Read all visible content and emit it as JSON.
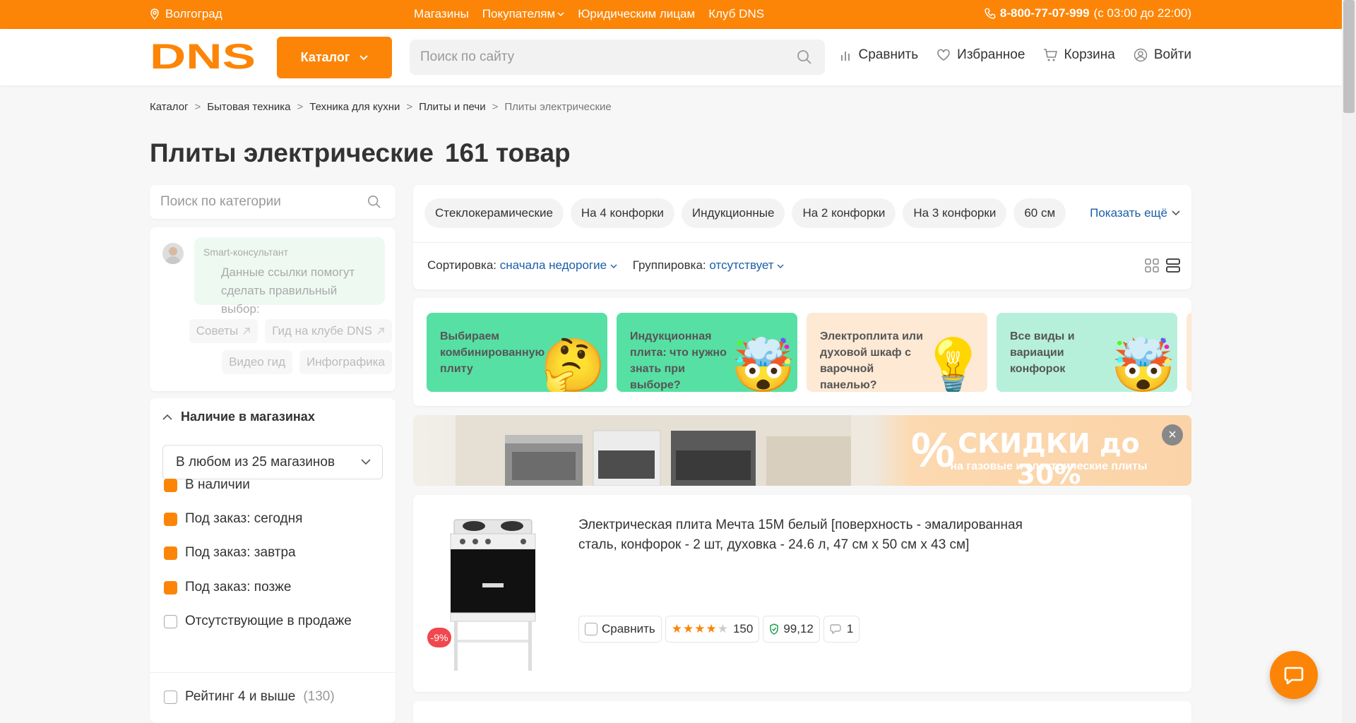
{
  "topbar": {
    "city": "Волгоград",
    "links": [
      "Магазины",
      "Покупателям",
      "Юридическим лицам",
      "Клуб DNS"
    ],
    "phone": "8-800-77-07-999",
    "hours": "(с 03:00 до 22:00)"
  },
  "header": {
    "logo": "DNS",
    "catalog_label": "Каталог",
    "search_placeholder": "Поиск по сайту",
    "nav": {
      "compare": "Сравнить",
      "favorites": "Избранное",
      "cart": "Корзина",
      "login": "Войти"
    }
  },
  "breadcrumb": [
    "Каталог",
    "Бытовая техника",
    "Техника для кухни",
    "Плиты и печи",
    "Плиты электрические"
  ],
  "page": {
    "title": "Плиты электрические",
    "count": "161 товар"
  },
  "sidebar": {
    "search_placeholder": "Поиск по категории",
    "smart": {
      "who": "Smart-консультант",
      "message": "Данные ссылки помогут сделать правильный выбор:",
      "chips": [
        "Советы",
        "Гид на клубе DNS",
        "Видео гид",
        "Инфографика"
      ]
    },
    "availability": {
      "title": "Наличие в магазинах",
      "select_value": "В любом из 25 магазинов",
      "options": [
        {
          "label": "В наличии",
          "checked": true
        },
        {
          "label": "Под заказ: сегодня",
          "checked": true
        },
        {
          "label": "Под заказ: завтра",
          "checked": true
        },
        {
          "label": "Под заказ: позже",
          "checked": true
        },
        {
          "label": "Отсутствующие в продаже",
          "checked": false
        }
      ],
      "rating_label": "Рейтинг 4 и выше",
      "rating_count": "(130)"
    }
  },
  "filters": {
    "tags": [
      "Стеклокерамические",
      "На 4 конфорки",
      "Индукционные",
      "На 2 конфорки",
      "На 3 конфорки",
      "60 см"
    ],
    "show_more": "Показать ещё",
    "sort_label": "Сортировка:",
    "sort_value": "сначала недорогие",
    "group_label": "Группировка:",
    "group_value": "отсутствует"
  },
  "guides": [
    {
      "title": "Выбираем комбинированную плиту",
      "emoji": "🤔",
      "color": "#57e0a4"
    },
    {
      "title": "Индукционная плита: что нужно знать при выборе?",
      "emoji": "🤯",
      "color": "#57e0a4"
    },
    {
      "title": "Электроплита или духовой шкаф с варочной панелью?",
      "emoji": "💡",
      "color": "#fde9d4"
    },
    {
      "title": "Все виды и вариации конфорок",
      "emoji": "🤯",
      "color": "#b6f0db"
    }
  ],
  "banner": {
    "percent": "%",
    "title": "СКИДКИ до 30%",
    "subtitle": "на газовые и электрические плиты"
  },
  "product": {
    "name": "Электрическая плита Мечта 15М белый [поверхность - эмалированная сталь, конфорок - 2 шт, духовка - 24.6 л, 47 см x 50 см x 43 см]",
    "discount": "-9%",
    "compare_label": "Сравнить",
    "rating": 4,
    "reviews": "150",
    "reliability": "99,12",
    "comments": "1"
  }
}
